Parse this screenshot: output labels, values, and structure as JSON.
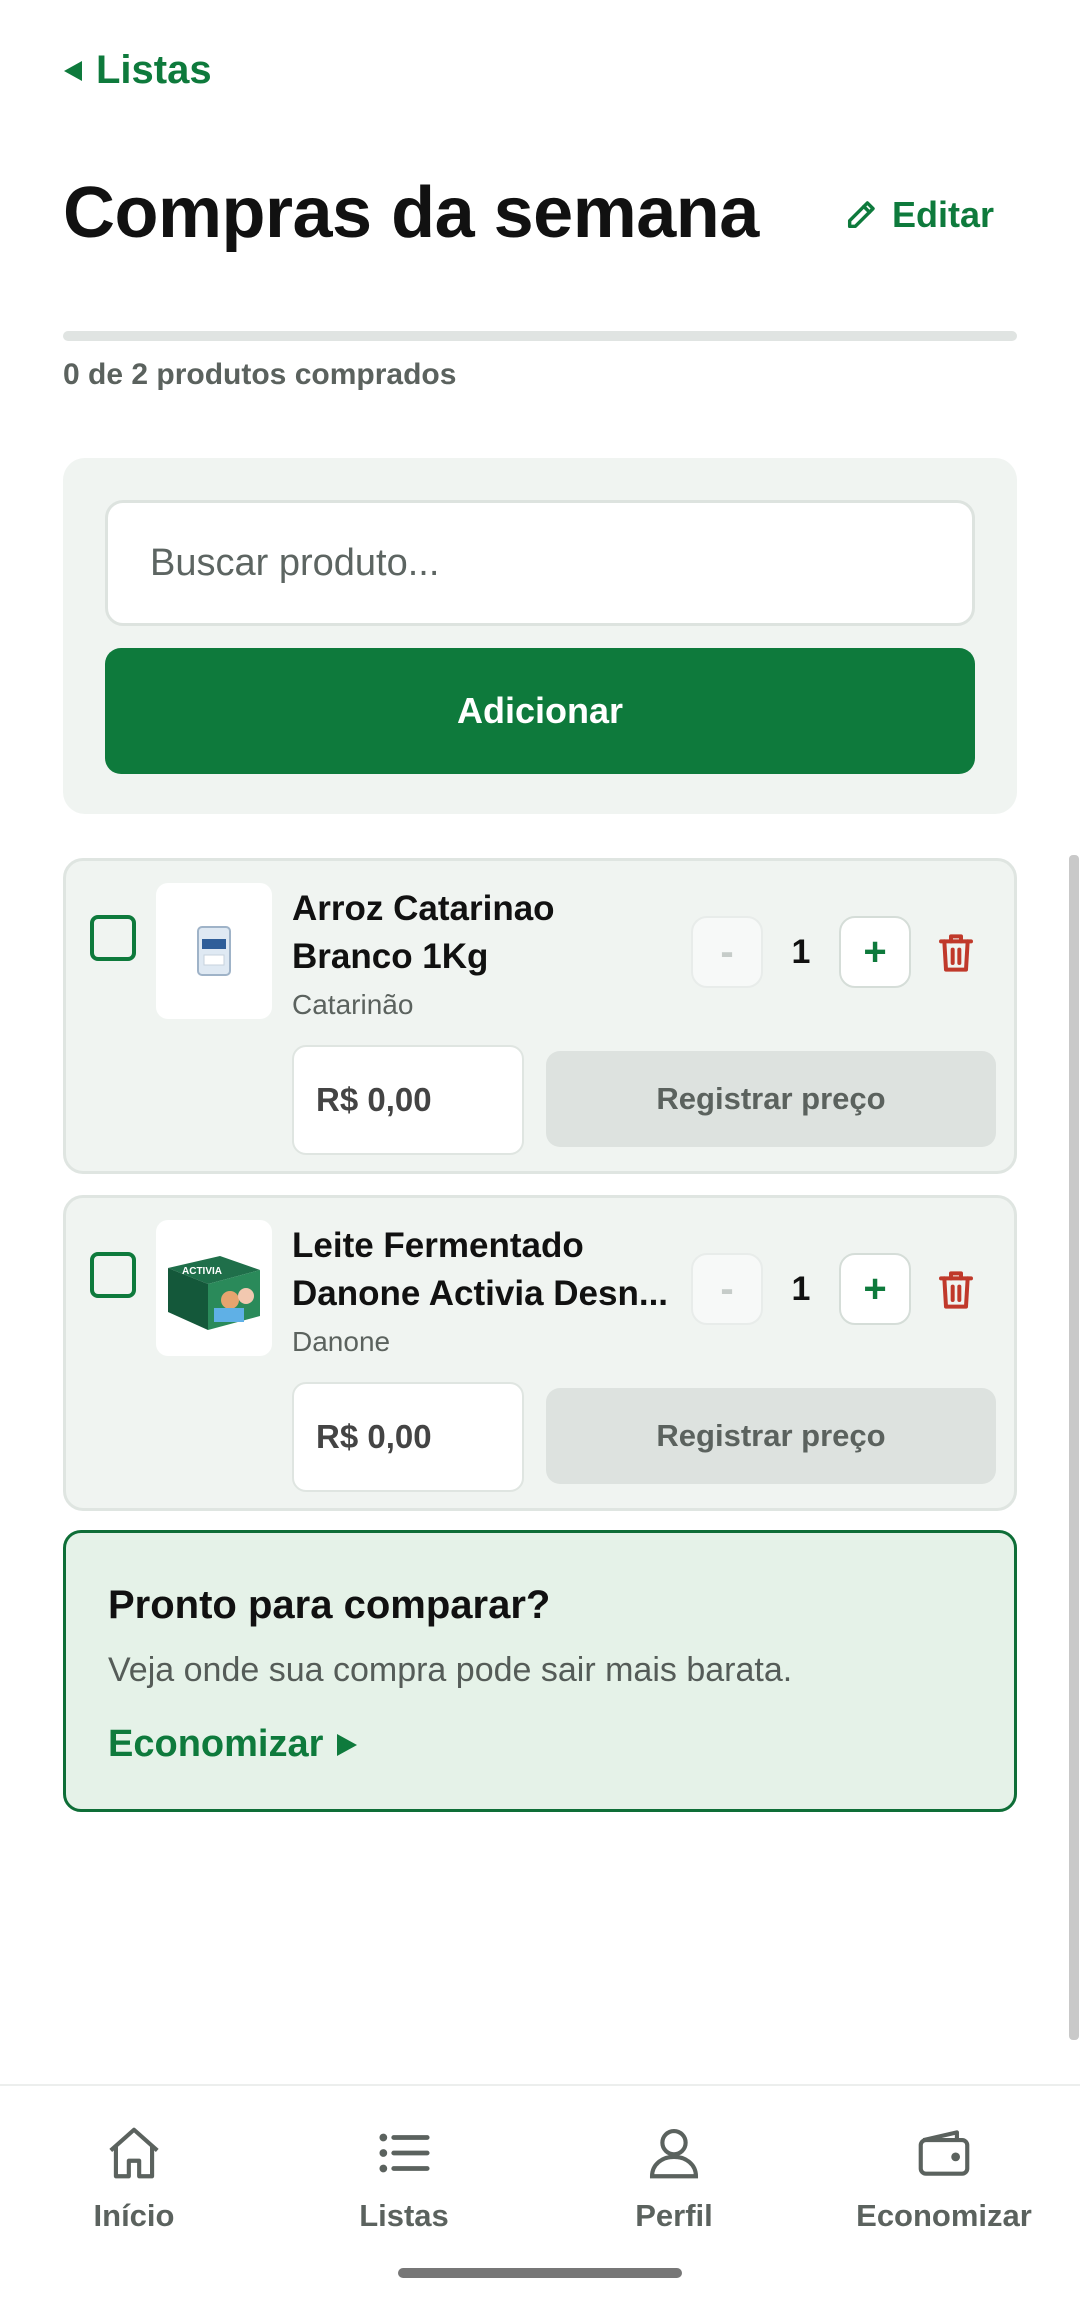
{
  "header": {
    "back_label": "Listas",
    "title": "Compras da semana",
    "edit_label": "Editar"
  },
  "progress": {
    "text": "0 de 2 produtos comprados",
    "fraction": 0
  },
  "search": {
    "placeholder": "Buscar produto...",
    "add_label": "Adicionar"
  },
  "products": [
    {
      "name_line1": "Arroz Catarinao",
      "name_line2": "Branco 1Kg",
      "brand": "Catarinão",
      "quantity": "1",
      "minus_label": "-",
      "plus_label": "+",
      "price": "R$ 0,00",
      "register_label": "Registrar preço",
      "image_icon": "rice-package-image",
      "checked": false
    },
    {
      "name_line1": "Leite Fermentado",
      "name_line2": "Danone Activia Desn...",
      "brand": "Danone",
      "quantity": "1",
      "minus_label": "-",
      "plus_label": "+",
      "price": "R$ 0,00",
      "register_label": "Registrar preço",
      "image_icon": "yogurt-pack-image",
      "checked": false
    }
  ],
  "compare": {
    "title": "Pronto para comparar?",
    "description": "Veja onde sua compra pode sair mais barata.",
    "link_label": "Economizar"
  },
  "nav": {
    "items": [
      {
        "label": "Início",
        "icon": "home-icon"
      },
      {
        "label": "Listas",
        "icon": "list-icon"
      },
      {
        "label": "Perfil",
        "icon": "user-icon"
      },
      {
        "label": "Economizar",
        "icon": "wallet-icon"
      }
    ]
  },
  "colors": {
    "primary": "#0e7a3c",
    "danger": "#c0392b",
    "surface": "#f0f4f1",
    "highlight": "#e5f2e8"
  }
}
